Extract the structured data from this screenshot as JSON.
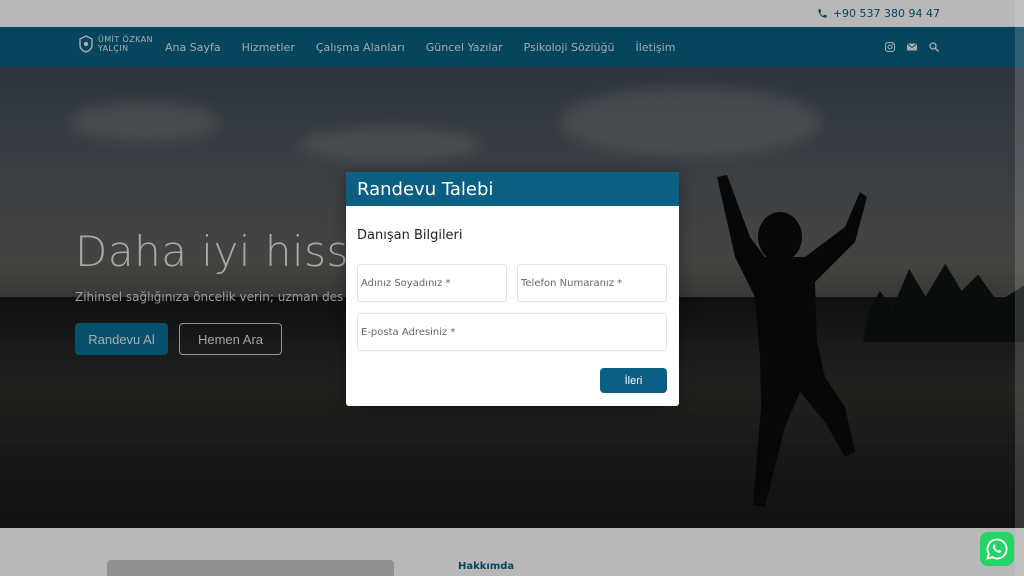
{
  "topbar": {
    "phone": "+90 537 380 94 47",
    "phone_icon": "phone-icon"
  },
  "logo": {
    "line1": "ÜMİT ÖZKAN",
    "line2": "YALÇIN"
  },
  "nav": {
    "links": [
      "Ana Sayfa",
      "Hizmetler",
      "Çalışma Alanları",
      "Güncel Yazılar",
      "Psikoloji Sözlüğü",
      "İletişim"
    ],
    "icons": [
      "instagram-icon",
      "mail-icon",
      "search-icon"
    ]
  },
  "hero": {
    "title": "Daha iyi hisset",
    "subtitle": "Zihinsel sağlığınıza öncelik verin; uzman des",
    "primary_button": "Randevu Al",
    "secondary_button": "Hemen Ara"
  },
  "about": {
    "label": "Hakkımda"
  },
  "modal": {
    "title": "Randevu Talebi",
    "section_title": "Danışan Bilgileri",
    "name_placeholder": "Adınız Soyadınız *",
    "phone_placeholder": "Telefon Numaranız *",
    "email_placeholder": "E-posta Adresiniz *",
    "next_button": "İleri"
  },
  "colors": {
    "brand": "#0b5f83",
    "whatsapp": "#25d366"
  }
}
